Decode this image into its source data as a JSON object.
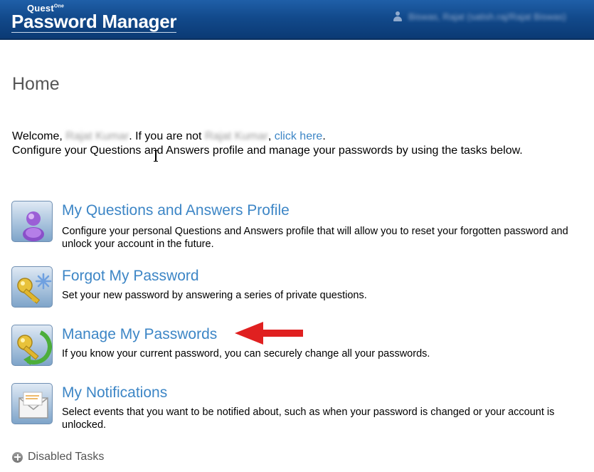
{
  "header": {
    "brand_small": "Quest",
    "brand_small_suffix": "One",
    "brand_big": "Password Manager",
    "user_name": "Biswas, Rajat (satish.raj/Rajat Biswas)",
    "user_icon": "user-icon"
  },
  "page": {
    "title": "Home"
  },
  "welcome": {
    "prefix": "Welcome, ",
    "name": "Rajat Kumar",
    "middle": ". If you are not ",
    "name2": "Rajat Kumar",
    "comma": ", ",
    "link": "click here",
    "suffix": ".",
    "configure": "Configure your Questions and Answers profile and manage your passwords by using the tasks below."
  },
  "tasks": [
    {
      "icon": "user-profile-icon",
      "title": "My Questions and Answers Profile",
      "description": "Configure your personal Questions and Answers profile that will allow you to reset your forgotten password and unlock your account in the future."
    },
    {
      "icon": "key-sparkle-icon",
      "title": "Forgot My Password",
      "description": "Set your new password by answering a series of private questions."
    },
    {
      "icon": "key-refresh-icon",
      "title": "Manage My Passwords",
      "description": "If you know your current password, you can securely change all your passwords."
    },
    {
      "icon": "envelope-icon",
      "title": "My Notifications",
      "description": "Select events that you want to be notified about, such as when your password is changed or your account is unlocked."
    }
  ],
  "annotation": {
    "arrow_color": "#e02020"
  },
  "footer": {
    "disabled_tasks": "Disabled Tasks",
    "icon": "plus-circle-icon"
  },
  "colors": {
    "header_bg": "#124a8c",
    "link": "#3d86c6",
    "title_text": "#555555"
  }
}
